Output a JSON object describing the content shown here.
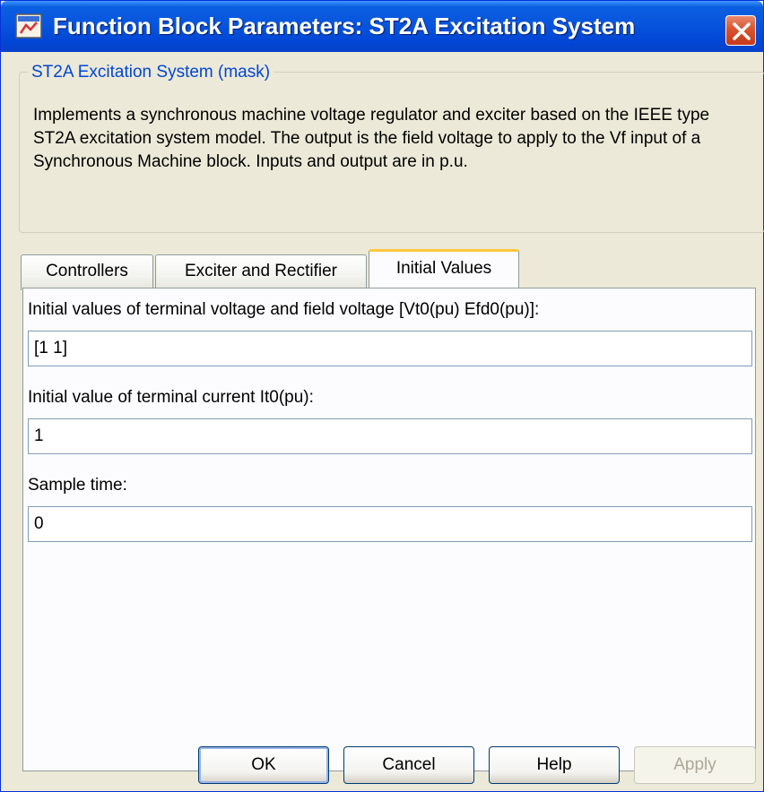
{
  "window": {
    "title": "Function Block Parameters: ST2A Excitation System",
    "icon": "simulink-block-icon"
  },
  "mask": {
    "legend": "ST2A Excitation System (mask)",
    "description": "Implements a synchronous machine voltage regulator and exciter based on the IEEE type ST2A excitation system model. The output is the field voltage to apply to the Vf input of a Synchronous Machine block. Inputs and output are in p.u."
  },
  "tabs": [
    {
      "label": "Controllers",
      "active": false
    },
    {
      "label": "Exciter and Rectifier",
      "active": false
    },
    {
      "label": "Initial Values",
      "active": true
    }
  ],
  "fields": [
    {
      "label": "Initial values of terminal voltage and field voltage [Vt0(pu) Efd0(pu)]:",
      "value": "[1 1]"
    },
    {
      "label": "Initial value of terminal current It0(pu):",
      "value": "1"
    },
    {
      "label": "Sample time:",
      "value": "0"
    }
  ],
  "buttons": {
    "ok": "OK",
    "cancel": "Cancel",
    "help": "Help",
    "apply": "Apply"
  },
  "colors": {
    "titlebar": "#0855dd",
    "legend_text": "#0046d5",
    "active_tab_accent": "#ffc83c"
  }
}
